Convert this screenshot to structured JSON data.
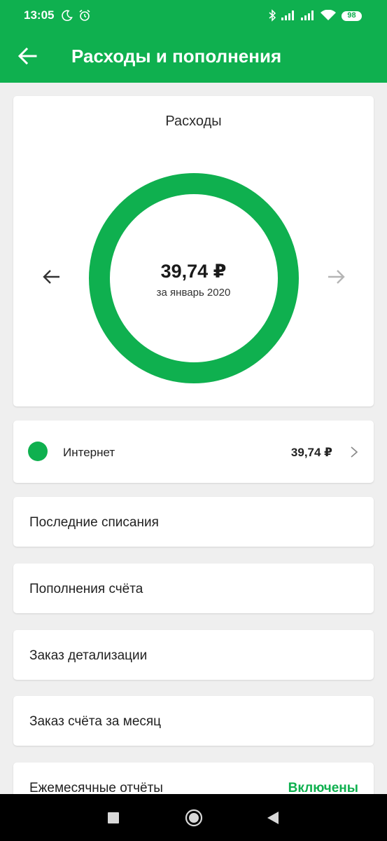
{
  "status_bar": {
    "time": "13:05",
    "battery": "98",
    "icons": [
      "moon-icon",
      "alarm-icon",
      "bluetooth-icon",
      "signal-icon",
      "signal-icon",
      "wifi-icon",
      "battery-icon"
    ]
  },
  "app_bar": {
    "title": "Расходы и пополнения",
    "back_icon": "arrow-left-icon"
  },
  "expenses_card": {
    "title": "Расходы",
    "amount": "39,74 ₽",
    "period": "за январь 2020",
    "prev_icon": "arrow-left-icon",
    "next_icon": "arrow-right-icon"
  },
  "chart_data": {
    "type": "pie",
    "title": "Расходы",
    "categories": [
      "Интернет"
    ],
    "values": [
      39.74
    ],
    "colors": [
      "#0fb04f"
    ]
  },
  "category_row": {
    "label": "Интернет",
    "value": "39,74 ₽",
    "color": "#0fb04f"
  },
  "menu": [
    {
      "label": "Последние списания"
    },
    {
      "label": "Пополнения счёта"
    },
    {
      "label": "Заказ детализации"
    },
    {
      "label": "Заказ счёта за месяц"
    },
    {
      "label": "Ежемесячные отчёты",
      "value": "Включены"
    }
  ],
  "colors": {
    "brand": "#0fb04f",
    "background": "#efefef",
    "text": "#1f1f1f"
  },
  "nav_bar": {
    "icons": [
      "recents-icon",
      "home-icon",
      "back-triangle-icon"
    ]
  }
}
